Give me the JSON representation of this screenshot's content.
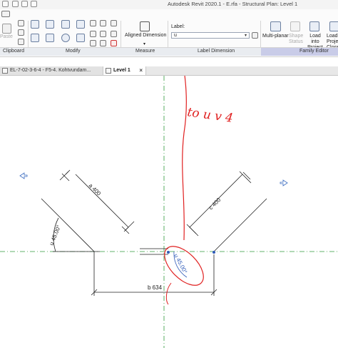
{
  "window": {
    "title": "Autodesk Revit 2020.1 - E.rfa - Structural Plan: Level 1"
  },
  "ribbon": {
    "clipboard": {
      "paste_label": "Paste",
      "panel_label": "Clipboard"
    },
    "modify": {
      "panel_label": "Modify"
    },
    "measure": {
      "aligned_dimension_label": "Aligned Dimension",
      "panel_label": "Measure"
    },
    "label_dimension": {
      "label_caption": "Label:",
      "label_value": "u",
      "panel_label": "Label Dimension"
    },
    "family_editor": {
      "multi_planar_label": "Multi-planar",
      "shape_status_label": "Shape Status",
      "load_into_project_label": "Load into Project",
      "load_into_project_close_label": "Load into Project and Close",
      "panel_label": "Family Editor"
    }
  },
  "tabs": [
    {
      "label": "EL-7-02-3-6-4 - F5-4. Kohtvundam..."
    },
    {
      "label": "Level 1"
    }
  ],
  "canvas": {
    "dimension_a": "a 400",
    "dimension_c": "c 400",
    "dimension_b": "b 634",
    "angle_left": "u 45.00°",
    "angle_center": "u 45.00°",
    "handwritten_note": "to u v 4"
  },
  "colors": {
    "ribbon_bg": "#fbfbfb",
    "family_editor_band": "#c9cce8",
    "reference_plane": "#2e9a3b",
    "annotation_red": "#e02020",
    "dimension_line": "#222222",
    "selected_dimension": "#2f5bb8"
  }
}
